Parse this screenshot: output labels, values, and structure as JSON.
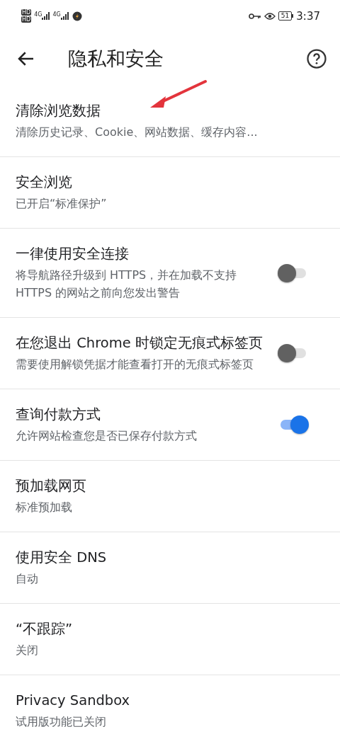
{
  "status_bar": {
    "sim_labels": [
      "HD",
      "HD"
    ],
    "network_labels": [
      "4G",
      "4G"
    ],
    "battery": "51",
    "time": "3:37"
  },
  "toolbar": {
    "title": "隐私和安全"
  },
  "settings": [
    {
      "kind": "link",
      "title": "清除浏览数据",
      "subtitle": "清除历史记录、Cookie、网站数据、缓存内容..."
    },
    {
      "kind": "link",
      "title": "安全浏览",
      "subtitle": "已开启“标准保护”"
    },
    {
      "kind": "toggle",
      "title": "一律使用安全连接",
      "subtitle": "将导航路径升级到 HTTPS，并在加载不支持 HTTPS 的网站之前向您发出警告",
      "on": false
    },
    {
      "kind": "toggle",
      "title": "在您退出 Chrome 时锁定无痕式标签页",
      "subtitle": "需要使用解锁凭据才能查看打开的无痕式标签页",
      "on": false
    },
    {
      "kind": "toggle",
      "title": "查询付款方式",
      "subtitle": "允许网站检查您是否已保存付款方式",
      "on": true
    },
    {
      "kind": "link",
      "title": "预加载网页",
      "subtitle": "标准预加载"
    },
    {
      "kind": "link",
      "title": "使用安全 DNS",
      "subtitle": "自动"
    },
    {
      "kind": "link",
      "title": "“不跟踪”",
      "subtitle": "关闭"
    },
    {
      "kind": "link",
      "title": "Privacy Sandbox",
      "subtitle": "试用版功能已关闭"
    }
  ]
}
